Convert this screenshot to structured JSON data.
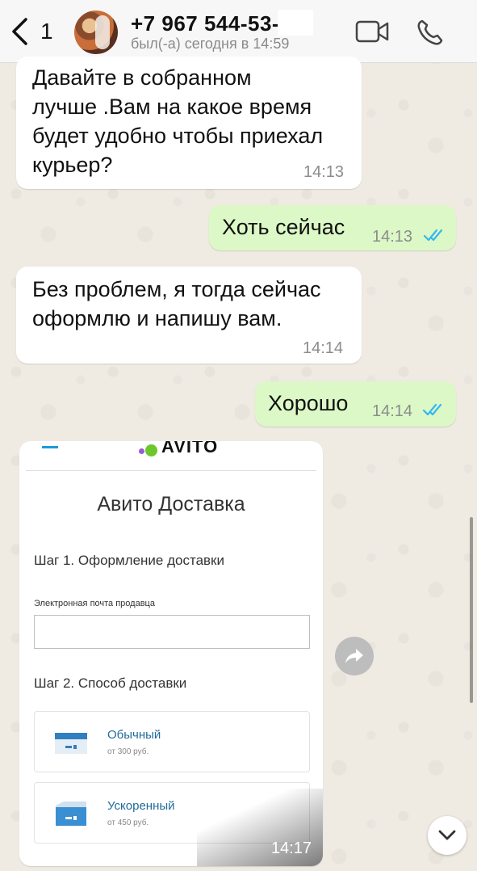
{
  "header": {
    "back_count": "1",
    "contact_name": "+7 967 544-53-",
    "last_seen": "был(-а) сегодня в 14:59"
  },
  "messages": [
    {
      "direction": "in",
      "text": "Давайте в собранном\nлучше .Вам на какое время\nбудет удобно чтобы приехал\nкурьер?",
      "time": "14:13"
    },
    {
      "direction": "out",
      "text": "Хоть сейчас",
      "time": "14:13",
      "status": "read"
    },
    {
      "direction": "in",
      "text": "Без проблем, я тогда сейчас\nоформлю и напишу вам.",
      "time": "14:14"
    },
    {
      "direction": "out",
      "text": "Хорошо",
      "time": "14:14",
      "status": "read"
    }
  ],
  "image_message": {
    "time": "14:17",
    "screenshot": {
      "logo": "AVITO",
      "title": "Авито Доставка",
      "step1": "Шаг 1. Оформление доставки",
      "email_label": "Электронная почта продавца",
      "email_value": "",
      "step2": "Шаг 2. Способ доставки",
      "options": [
        {
          "name": "Обычный",
          "price": "от 300 руб."
        },
        {
          "name": "Ускоренный",
          "price": "от 450 руб."
        }
      ]
    }
  },
  "icons": {
    "back": "chevron-left-icon",
    "video": "video-camera-icon",
    "call": "phone-icon",
    "forward": "forward-arrow-icon",
    "scroll_down": "chevron-down-icon",
    "read_receipt": "double-check-icon"
  },
  "colors": {
    "outgoing_bubble": "#dcf8c6",
    "incoming_bubble": "#ffffff",
    "read_tick": "#34b7f1",
    "chat_background": "#efeae2"
  }
}
